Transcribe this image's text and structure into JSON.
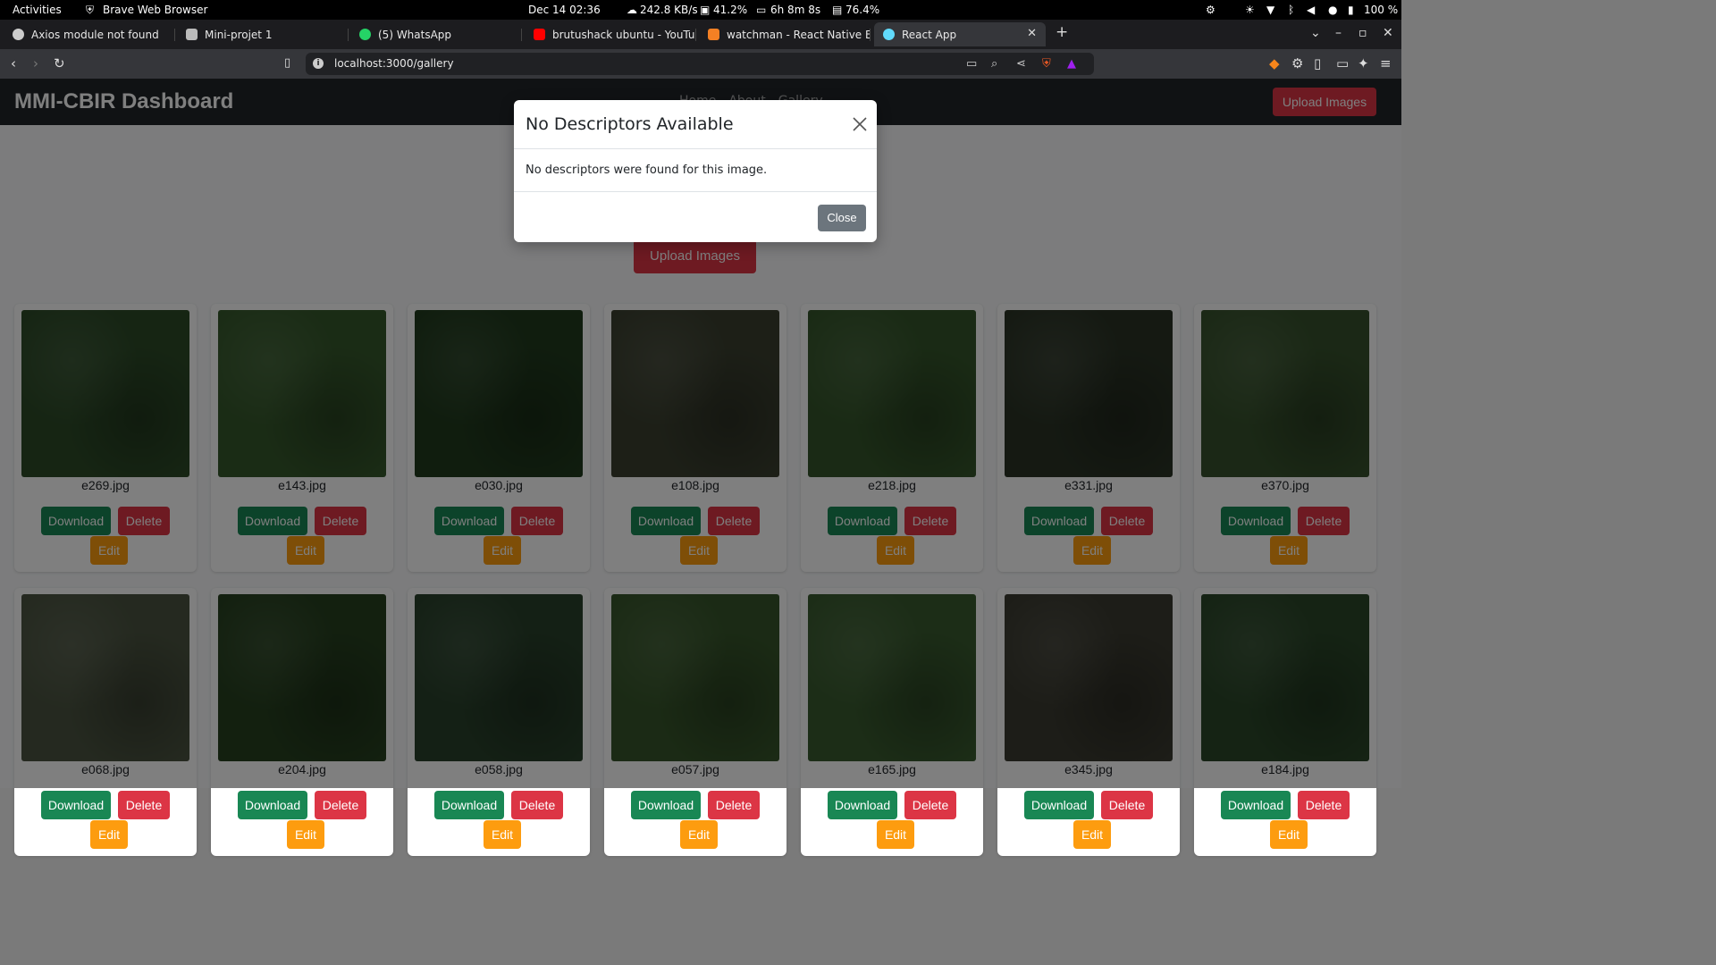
{
  "system": {
    "activities": "Activities",
    "app_name": "Brave Web Browser",
    "datetime": "Dec 14  02:36",
    "net": "242.8 KB/s",
    "disk": "41.2%",
    "uptime": "6h 8m 8s",
    "cpu": "76.4%",
    "battery": "100 %"
  },
  "tabs": [
    {
      "title": "Axios module not found",
      "icon_color": "#cccccc"
    },
    {
      "title": "Mini-projet 1",
      "icon_color": "#bbbbbb"
    },
    {
      "title": "(5) WhatsApp",
      "icon_color": "#25d366"
    },
    {
      "title": "brutushack ubuntu - YouTub",
      "icon_color": "#ff0000"
    },
    {
      "title": "watchman - React Native Er",
      "icon_color": "#f48024"
    },
    {
      "title": "React App",
      "icon_color": "#61dafb"
    }
  ],
  "address_bar": {
    "url": "localhost:3000/gallery"
  },
  "app": {
    "brand": "MMI-CBIR Dashboard",
    "nav_links": [
      "Home",
      "About",
      "Gallery"
    ],
    "nav_upload_label": "Upload Images",
    "hero_upload_label": "Upload Images",
    "download_label": "Download",
    "delete_label": "Delete",
    "edit_label": "Edit",
    "images": [
      {
        "name": "e269.jpg",
        "color": "#2c4a27"
      },
      {
        "name": "e143.jpg",
        "color": "#35582b"
      },
      {
        "name": "e030.jpg",
        "color": "#203a1d"
      },
      {
        "name": "e108.jpg",
        "color": "#3a3f2f"
      },
      {
        "name": "e218.jpg",
        "color": "#34552a"
      },
      {
        "name": "e331.jpg",
        "color": "#2a3325"
      },
      {
        "name": "e370.jpg",
        "color": "#36512c"
      },
      {
        "name": "e068.jpg",
        "color": "#4a5340"
      },
      {
        "name": "e204.jpg",
        "color": "#26401f"
      },
      {
        "name": "e058.jpg",
        "color": "#28402a"
      },
      {
        "name": "e057.jpg",
        "color": "#36552a"
      },
      {
        "name": "e165.jpg",
        "color": "#385a2e"
      },
      {
        "name": "e345.jpg",
        "color": "#3a3a30"
      },
      {
        "name": "e184.jpg",
        "color": "#2a4628"
      }
    ]
  },
  "modal": {
    "title": "No Descriptors Available",
    "body": "No descriptors were found for this image.",
    "close_label": "Close"
  }
}
